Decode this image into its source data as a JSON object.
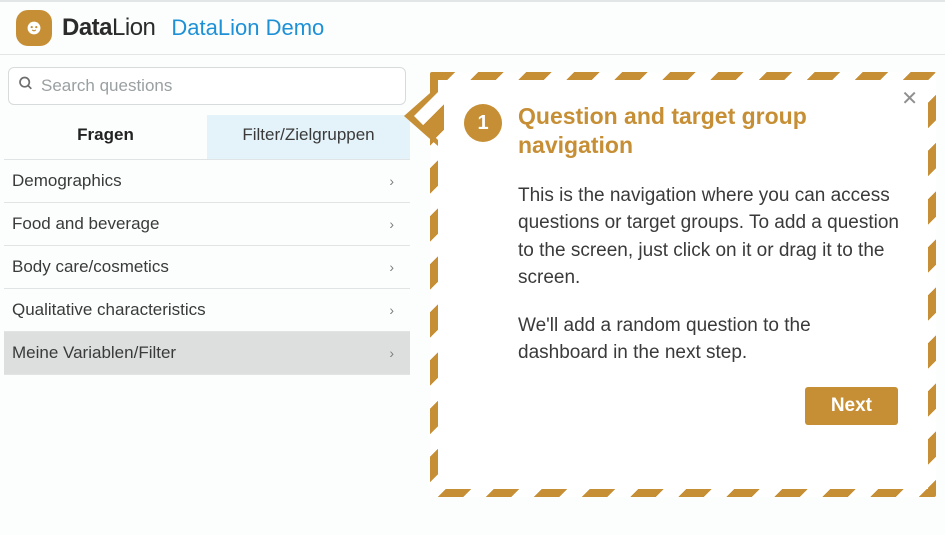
{
  "header": {
    "brand_data": "Data",
    "brand_lion": "Lion",
    "demo_link": "DataLion Demo"
  },
  "search": {
    "placeholder": "Search questions",
    "value": ""
  },
  "tabs": [
    {
      "label": "Fragen",
      "active": true
    },
    {
      "label": "Filter/Zielgruppen",
      "active": false
    }
  ],
  "nav_items": [
    {
      "label": "Demographics",
      "selected": false
    },
    {
      "label": "Food and beverage",
      "selected": false
    },
    {
      "label": "Body care/cosmetics",
      "selected": false
    },
    {
      "label": "Qualitative characteristics",
      "selected": false
    },
    {
      "label": "Meine Variablen/Filter",
      "selected": true
    }
  ],
  "tour": {
    "step": "1",
    "title": "Question and target group navigation",
    "para1": "This is the navigation where you can access questions or target groups. To add a question to the screen, just click on it or drag it to the screen.",
    "para2": "We'll add a random question to the dashboard in the next step.",
    "next_label": "Next"
  },
  "colors": {
    "accent": "#c68f35",
    "link": "#1e90d6"
  }
}
